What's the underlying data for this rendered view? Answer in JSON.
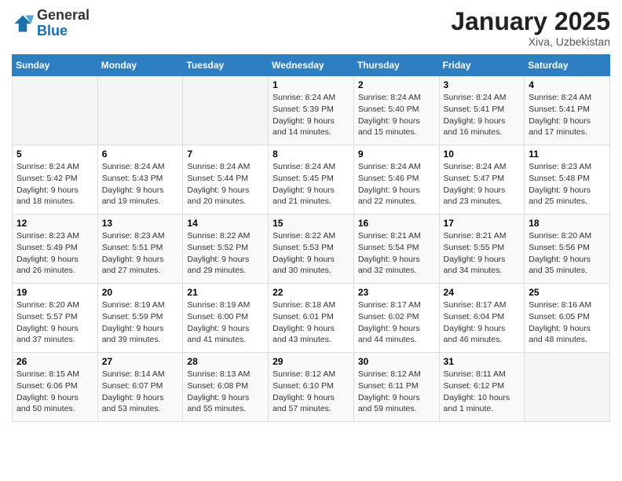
{
  "header": {
    "logo_line1": "General",
    "logo_line2": "Blue",
    "month": "January 2025",
    "location": "Xiva, Uzbekistan"
  },
  "days_of_week": [
    "Sunday",
    "Monday",
    "Tuesday",
    "Wednesday",
    "Thursday",
    "Friday",
    "Saturday"
  ],
  "weeks": [
    [
      {
        "day": "",
        "info": ""
      },
      {
        "day": "",
        "info": ""
      },
      {
        "day": "",
        "info": ""
      },
      {
        "day": "1",
        "info": "Sunrise: 8:24 AM\nSunset: 5:39 PM\nDaylight: 9 hours\nand 14 minutes."
      },
      {
        "day": "2",
        "info": "Sunrise: 8:24 AM\nSunset: 5:40 PM\nDaylight: 9 hours\nand 15 minutes."
      },
      {
        "day": "3",
        "info": "Sunrise: 8:24 AM\nSunset: 5:41 PM\nDaylight: 9 hours\nand 16 minutes."
      },
      {
        "day": "4",
        "info": "Sunrise: 8:24 AM\nSunset: 5:41 PM\nDaylight: 9 hours\nand 17 minutes."
      }
    ],
    [
      {
        "day": "5",
        "info": "Sunrise: 8:24 AM\nSunset: 5:42 PM\nDaylight: 9 hours\nand 18 minutes."
      },
      {
        "day": "6",
        "info": "Sunrise: 8:24 AM\nSunset: 5:43 PM\nDaylight: 9 hours\nand 19 minutes."
      },
      {
        "day": "7",
        "info": "Sunrise: 8:24 AM\nSunset: 5:44 PM\nDaylight: 9 hours\nand 20 minutes."
      },
      {
        "day": "8",
        "info": "Sunrise: 8:24 AM\nSunset: 5:45 PM\nDaylight: 9 hours\nand 21 minutes."
      },
      {
        "day": "9",
        "info": "Sunrise: 8:24 AM\nSunset: 5:46 PM\nDaylight: 9 hours\nand 22 minutes."
      },
      {
        "day": "10",
        "info": "Sunrise: 8:24 AM\nSunset: 5:47 PM\nDaylight: 9 hours\nand 23 minutes."
      },
      {
        "day": "11",
        "info": "Sunrise: 8:23 AM\nSunset: 5:48 PM\nDaylight: 9 hours\nand 25 minutes."
      }
    ],
    [
      {
        "day": "12",
        "info": "Sunrise: 8:23 AM\nSunset: 5:49 PM\nDaylight: 9 hours\nand 26 minutes."
      },
      {
        "day": "13",
        "info": "Sunrise: 8:23 AM\nSunset: 5:51 PM\nDaylight: 9 hours\nand 27 minutes."
      },
      {
        "day": "14",
        "info": "Sunrise: 8:22 AM\nSunset: 5:52 PM\nDaylight: 9 hours\nand 29 minutes."
      },
      {
        "day": "15",
        "info": "Sunrise: 8:22 AM\nSunset: 5:53 PM\nDaylight: 9 hours\nand 30 minutes."
      },
      {
        "day": "16",
        "info": "Sunrise: 8:21 AM\nSunset: 5:54 PM\nDaylight: 9 hours\nand 32 minutes."
      },
      {
        "day": "17",
        "info": "Sunrise: 8:21 AM\nSunset: 5:55 PM\nDaylight: 9 hours\nand 34 minutes."
      },
      {
        "day": "18",
        "info": "Sunrise: 8:20 AM\nSunset: 5:56 PM\nDaylight: 9 hours\nand 35 minutes."
      }
    ],
    [
      {
        "day": "19",
        "info": "Sunrise: 8:20 AM\nSunset: 5:57 PM\nDaylight: 9 hours\nand 37 minutes."
      },
      {
        "day": "20",
        "info": "Sunrise: 8:19 AM\nSunset: 5:59 PM\nDaylight: 9 hours\nand 39 minutes."
      },
      {
        "day": "21",
        "info": "Sunrise: 8:19 AM\nSunset: 6:00 PM\nDaylight: 9 hours\nand 41 minutes."
      },
      {
        "day": "22",
        "info": "Sunrise: 8:18 AM\nSunset: 6:01 PM\nDaylight: 9 hours\nand 43 minutes."
      },
      {
        "day": "23",
        "info": "Sunrise: 8:17 AM\nSunset: 6:02 PM\nDaylight: 9 hours\nand 44 minutes."
      },
      {
        "day": "24",
        "info": "Sunrise: 8:17 AM\nSunset: 6:04 PM\nDaylight: 9 hours\nand 46 minutes."
      },
      {
        "day": "25",
        "info": "Sunrise: 8:16 AM\nSunset: 6:05 PM\nDaylight: 9 hours\nand 48 minutes."
      }
    ],
    [
      {
        "day": "26",
        "info": "Sunrise: 8:15 AM\nSunset: 6:06 PM\nDaylight: 9 hours\nand 50 minutes."
      },
      {
        "day": "27",
        "info": "Sunrise: 8:14 AM\nSunset: 6:07 PM\nDaylight: 9 hours\nand 53 minutes."
      },
      {
        "day": "28",
        "info": "Sunrise: 8:13 AM\nSunset: 6:08 PM\nDaylight: 9 hours\nand 55 minutes."
      },
      {
        "day": "29",
        "info": "Sunrise: 8:12 AM\nSunset: 6:10 PM\nDaylight: 9 hours\nand 57 minutes."
      },
      {
        "day": "30",
        "info": "Sunrise: 8:12 AM\nSunset: 6:11 PM\nDaylight: 9 hours\nand 59 minutes."
      },
      {
        "day": "31",
        "info": "Sunrise: 8:11 AM\nSunset: 6:12 PM\nDaylight: 10 hours\nand 1 minute."
      },
      {
        "day": "",
        "info": ""
      }
    ]
  ]
}
